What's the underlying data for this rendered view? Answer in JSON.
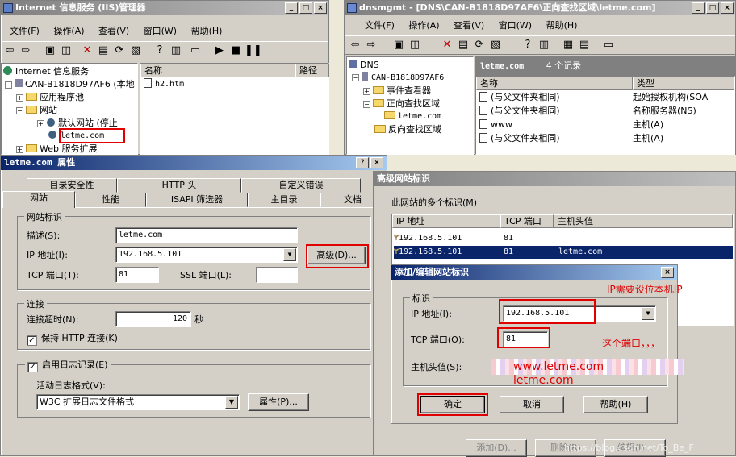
{
  "iis": {
    "title": "Internet 信息服务 (IIS)管理器",
    "menu": [
      "文件(F)",
      "操作(A)",
      "查看(V)",
      "窗口(W)",
      "帮助(H)"
    ],
    "tree": [
      "Internet 信息服务",
      "CAN-B1818D97AF6 (本地",
      "应用程序池",
      "网站",
      "默认网站 (停止",
      "letme.com",
      "Web 服务扩展"
    ],
    "cols": [
      "名称",
      "路径"
    ],
    "files": [
      "h2.htm"
    ]
  },
  "dns": {
    "title": "dnsmgmt - [DNS\\CAN-B1818D97AF6\\正向查找区域\\letme.com]",
    "menu": [
      "文件(F)",
      "操作(A)",
      "查看(V)",
      "窗口(W)",
      "帮助(H)"
    ],
    "tree": [
      "DNS",
      "CAN-B1818D97AF6",
      "事件查看器",
      "正向查找区域",
      "letme.com",
      "反向查找区域"
    ],
    "zone": "letme.com",
    "count": "4 个记录",
    "cols": [
      "名称",
      "类型"
    ],
    "records": [
      {
        "name": "(与父文件夹相同)",
        "type": "起始授权机构(SOA"
      },
      {
        "name": "(与父文件夹相同)",
        "type": "名称服务器(NS)"
      },
      {
        "name": "www",
        "type": "主机(A)"
      },
      {
        "name": "(与父文件夹相同)",
        "type": "主机(A)"
      }
    ]
  },
  "props": {
    "title": "letme.com 属性",
    "help_btn": "?",
    "tabs_row1": [
      "目录安全性",
      "HTTP 头",
      "自定义错误"
    ],
    "tabs_row2": [
      "网站",
      "性能",
      "ISAPI 筛选器",
      "主目录",
      "文档"
    ],
    "group_site": "网站标识",
    "desc_label": "描述(S):",
    "desc_value": "letme.com",
    "ip_label": "IP 地址(I):",
    "ip_value": "192.168.5.101",
    "advanced_btn": "高级(D)...",
    "tcp_label": "TCP 端口(T):",
    "tcp_value": "81",
    "ssl_label": "SSL 端口(L):",
    "ssl_value": "",
    "group_conn": "连接",
    "timeout_label": "连接超时(N):",
    "timeout_value": "120",
    "timeout_unit": "秒",
    "keepalive_label": "保持 HTTP 连接(K)",
    "log_label": "启用日志记录(E)",
    "logfmt_label": "活动日志格式(V):",
    "logfmt_value": "W3C 扩展日志文件格式",
    "log_props_btn": "属性(P)..."
  },
  "adv": {
    "title": "高级网站标识",
    "list_label": "此网站的多个标识(M)",
    "cols": [
      "IP 地址",
      "TCP 端口",
      "主机头值"
    ],
    "rows": [
      {
        "ip": "192.168.5.101",
        "port": "81",
        "host": ""
      },
      {
        "ip": "192.168.5.101",
        "port": "81",
        "host": "letme.com"
      }
    ],
    "add_btn": "添加(D)...",
    "delete_btn": "删除(R)",
    "edit_btn": "编辑(I)...",
    "watermark": "https://blog.csdn.net/To_Be_F"
  },
  "edit": {
    "title": "添加/编辑网站标识",
    "group": "标识",
    "ip_label": "IP 地址(I):",
    "ip_value": "192.168.5.101",
    "tcp_label": "TCP 端口(O):",
    "tcp_value": "81",
    "host_label": "主机头值(S):",
    "host_value": "www.letme.com",
    "ok_btn": "确定",
    "cancel_btn": "取消",
    "help_btn": "帮助(H)"
  },
  "annotations": {
    "ip_note": "IP需要设位本机IP",
    "port_note": "这个端口，，，",
    "host_note1": "www.letme.com",
    "host_note2": "letme.com"
  },
  "colors": {
    "highlight": "#0a246a",
    "annotation": "#e00000",
    "face": "#d4d0c8"
  }
}
